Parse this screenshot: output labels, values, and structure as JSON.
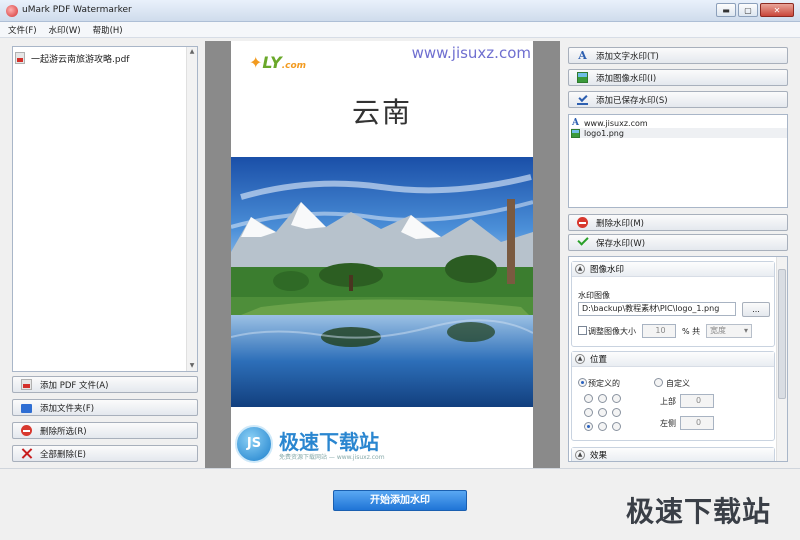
{
  "window": {
    "title": "uMark PDF Watermarker"
  },
  "menu": [
    "文件(F)",
    "水印(W)",
    "帮助(H)"
  ],
  "files": {
    "items": [
      "一起游云南旅游攻略.pdf"
    ]
  },
  "left_buttons": {
    "add_pdf": "添加 PDF 文件(A)",
    "add_folder": "添加文件夹(F)",
    "remove_selected": "删除所选(R)",
    "remove_all": "全部删除(E)"
  },
  "preview": {
    "watermark_text": "www.jisuxz.com",
    "logo_text": "LY",
    "logo_suffix": ".com",
    "title": "云南",
    "bottom_logo_mark": "JS",
    "bottom_logo_name": "极速下载站",
    "bottom_logo_sub": "免费资源下载网站 — www.jisuxz.com"
  },
  "right_buttons": {
    "add_text": "添加文字水印(T)",
    "add_image": "添加图像水印(I)",
    "add_saved": "添加已保存水印(S)",
    "delete": "删除水印(M)",
    "save": "保存水印(W)"
  },
  "saved_watermarks": [
    "www.jisuxz.com",
    "logo1.png"
  ],
  "image_section": {
    "header": "图像水印",
    "image_label": "水印图像",
    "image_path": "D:\\backup\\教程素材\\PIC\\logo_1.png",
    "browse": "...",
    "resize_label": "调整图像大小",
    "resize_value": "10",
    "percent_label": "% 共",
    "dimension_option": "宽度"
  },
  "position_section": {
    "header": "位置",
    "preset_label": "预定义的",
    "custom_label": "自定义",
    "top_label": "上部",
    "top_value": "0",
    "left_label": "左侧",
    "left_value": "0"
  },
  "effect_section": {
    "header": "效果"
  },
  "start_button": "开始添加水印",
  "brand": "极速下载站"
}
